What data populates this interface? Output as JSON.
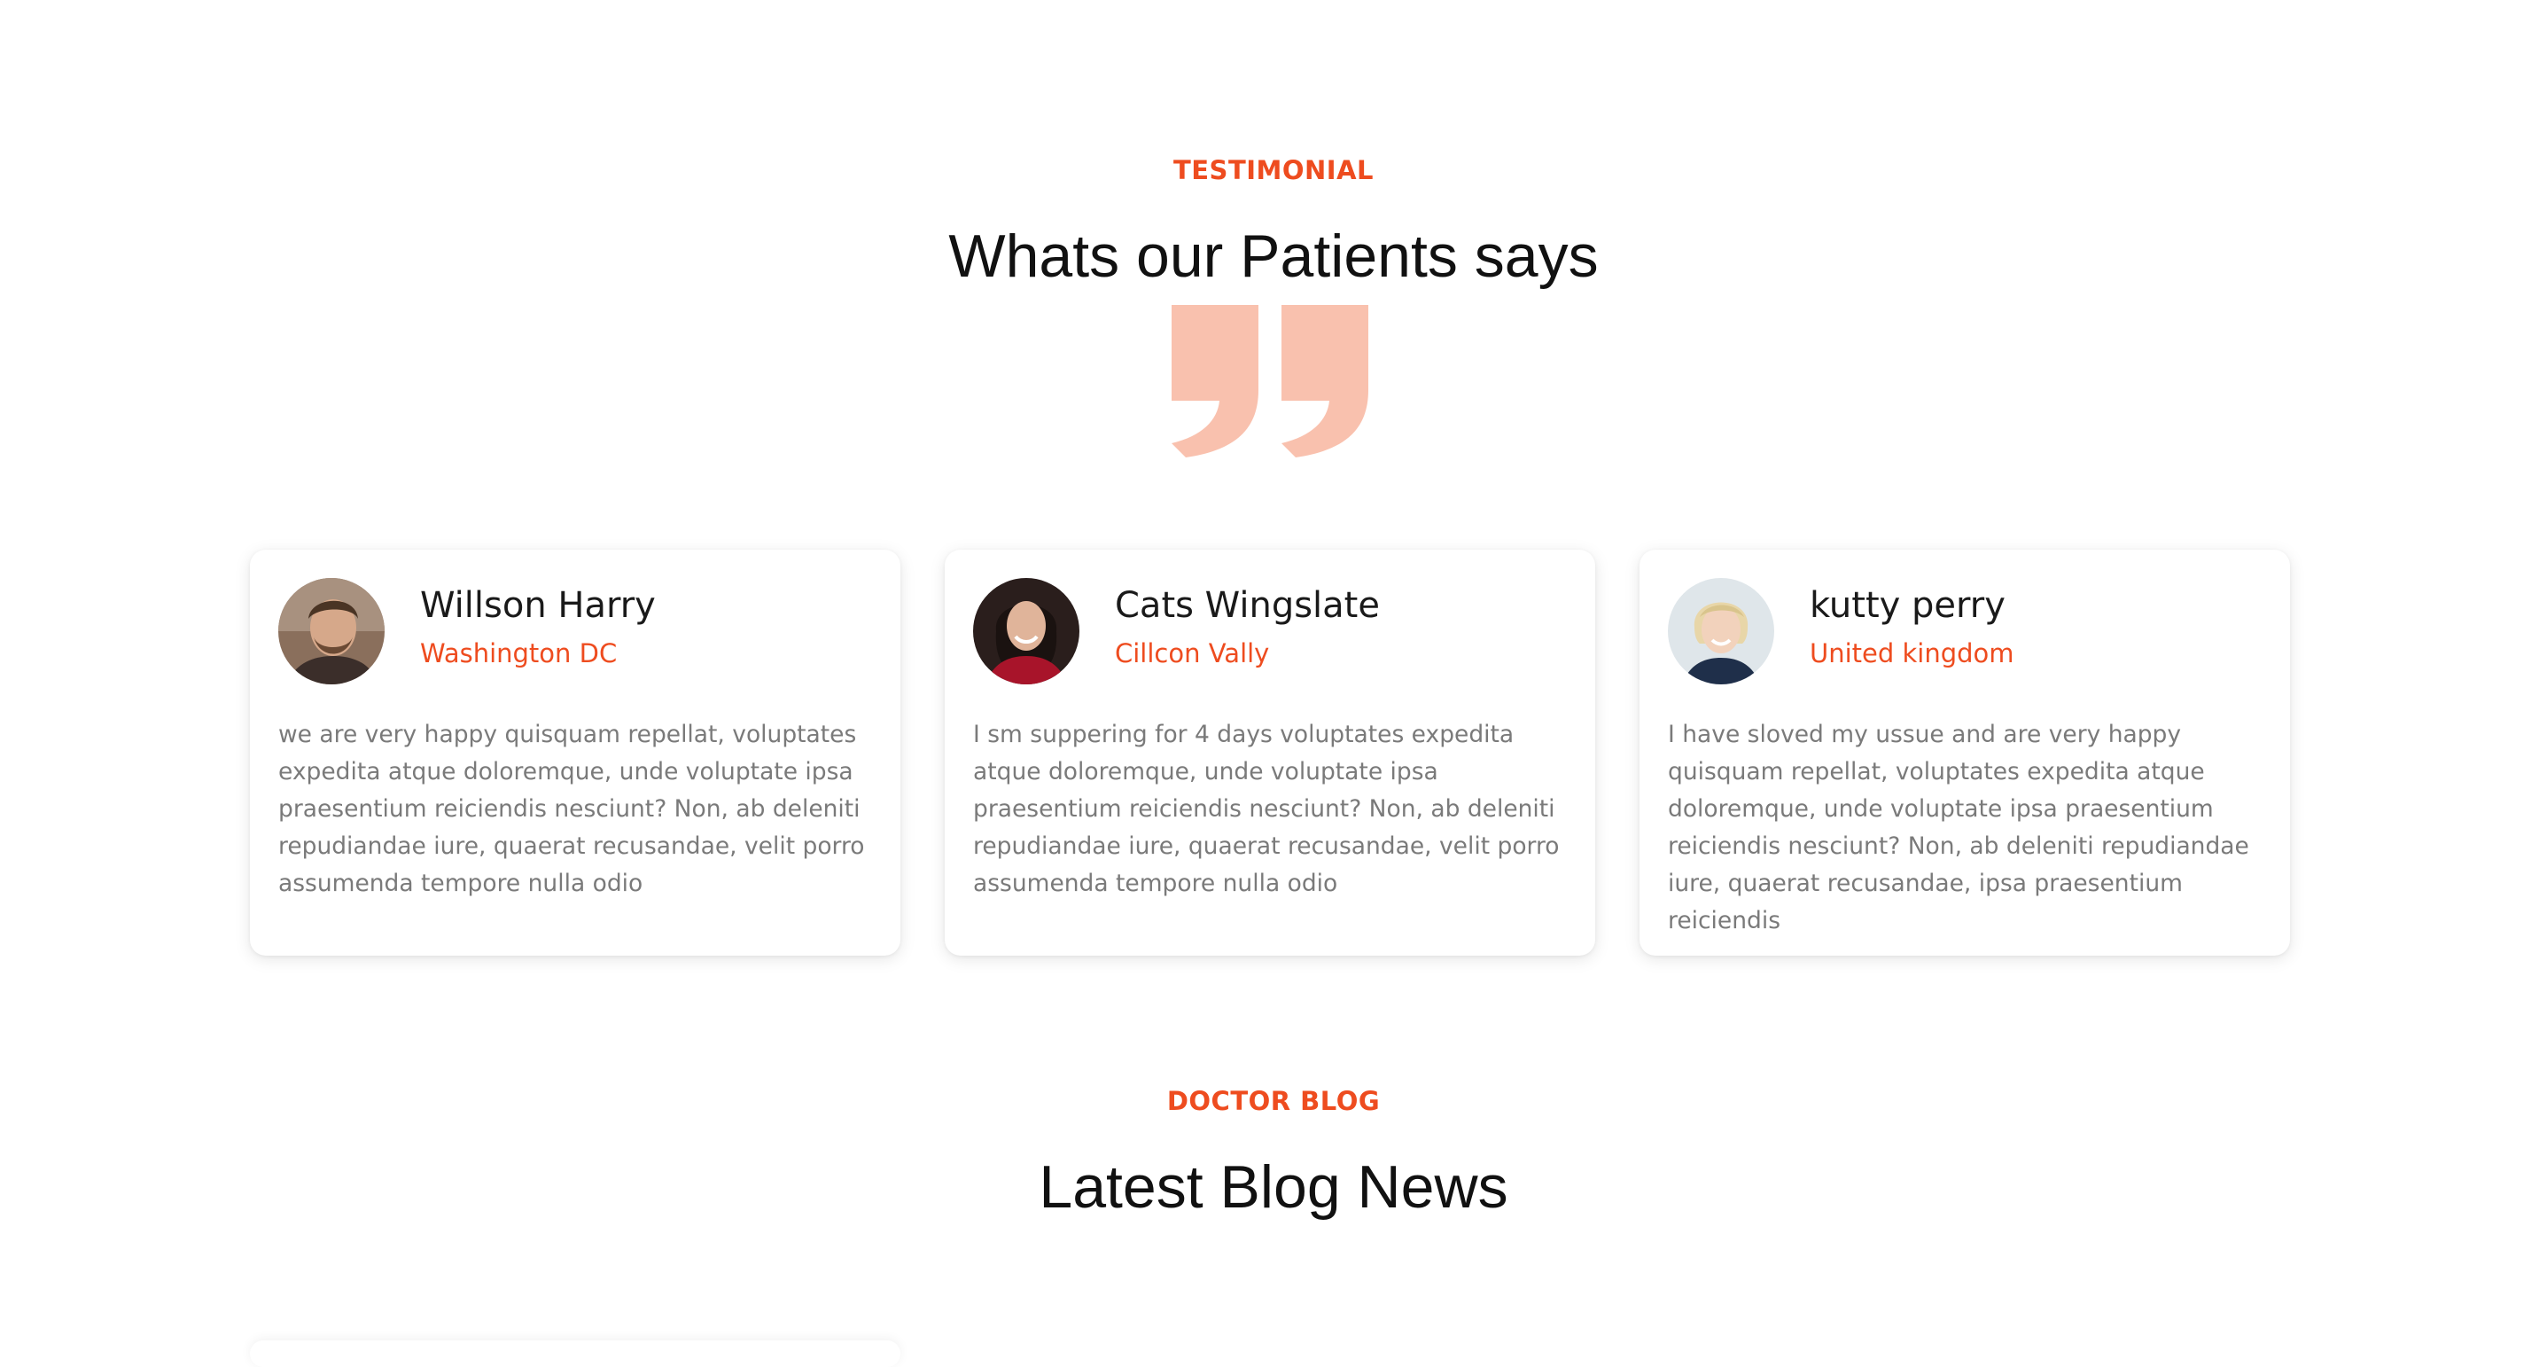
{
  "testimonial": {
    "eyebrow": "TESTIMONIAL",
    "heading": "Whats our Patients says",
    "quote_icon": "quote-mark-icon",
    "accent_color": "#ee4c1f",
    "quote_color": "#f9c1ae",
    "cards": [
      {
        "name": "Willson Harry",
        "location": "Washington DC",
        "text": "we are very happy quisquam repellat, voluptates expedita atque doloremque, unde voluptate ipsa praesentium reiciendis nesciunt? Non, ab deleniti repudiandae iure, quaerat recusandae, velit porro assumenda tempore nulla odio"
      },
      {
        "name": "Cats Wingslate",
        "location": "Cillcon Vally",
        "text": "I sm suppering for 4 days voluptates expedita atque doloremque, unde voluptate ipsa praesentium reiciendis nesciunt? Non, ab deleniti repudiandae iure, quaerat recusandae, velit porro assumenda tempore nulla odio"
      },
      {
        "name": "kutty perry",
        "location": "United kingdom",
        "text": "I have sloved my ussue and are very happy quisquam repellat, voluptates expedita atque doloremque, unde voluptate ipsa praesentium reiciendis nesciunt? Non, ab deleniti repudiandae iure, quaerat recusandae, ipsa praesentium reiciendis"
      }
    ]
  },
  "blog": {
    "eyebrow": "DOCTOR BLOG",
    "heading": "Latest Blog News"
  }
}
